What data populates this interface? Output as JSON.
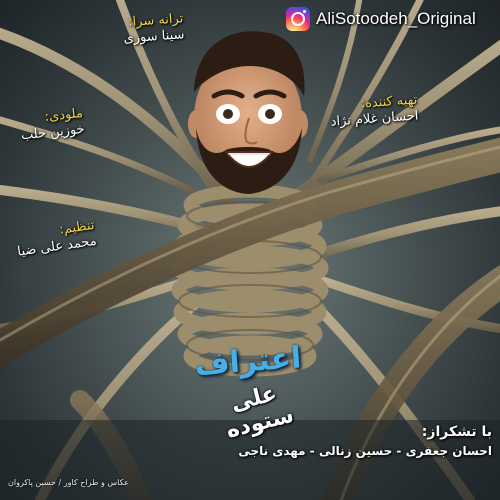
{
  "instagram": {
    "icon": "instagram-icon",
    "handle": "AliSotoodeh_Original"
  },
  "credits": {
    "lyrics": {
      "label": "ترانه سرا:",
      "value": "سینا سوری"
    },
    "mix": {
      "label": "تهیه کننده:",
      "value": "احسان غلام نژاد"
    },
    "melody": {
      "label": "ملودی:",
      "value": "خوزین حلب"
    },
    "arrange": {
      "label": "تنظیم:",
      "value": "محمد علی ضیا"
    }
  },
  "title": {
    "song": "اعتراف",
    "artist": "علی ستوده"
  },
  "thanks": {
    "label": "با تشکراز:",
    "names": "احسان جعفری - حسین زنالی - مهدی ناجی"
  },
  "photo_credit": "عکاس و طراح کاور / حسین پاکروان",
  "colors": {
    "background": "#4b5656",
    "rope": "#a99a7a",
    "credit_label": "#f2d24a",
    "title": "#4aaee6",
    "text": "#ffffff"
  }
}
